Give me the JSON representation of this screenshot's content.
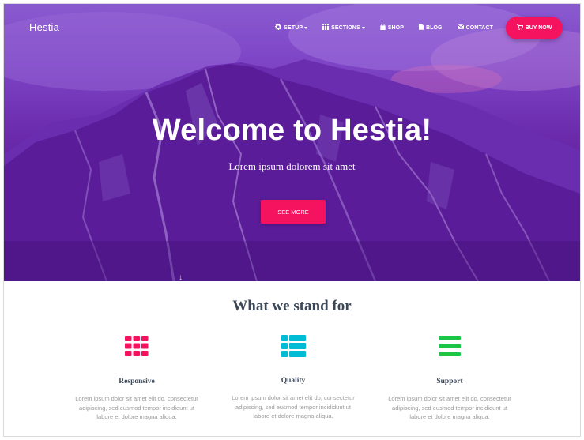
{
  "brand": "Hestia",
  "nav": {
    "items": [
      {
        "label": "SETUP",
        "icon": "gear-icon",
        "dropdown": true
      },
      {
        "label": "SECTIONS",
        "icon": "grid-icon",
        "dropdown": true
      },
      {
        "label": "SHOP",
        "icon": "shopping-bag-icon",
        "dropdown": false
      },
      {
        "label": "BLOG",
        "icon": "file-icon",
        "dropdown": false
      },
      {
        "label": "CONTACT",
        "icon": "envelope-icon",
        "dropdown": false
      }
    ],
    "cta": {
      "label": "BUY NOW",
      "icon": "cart-icon"
    }
  },
  "hero": {
    "title": "Welcome to Hestia!",
    "subtitle": "Lorem ipsum dolorem sit amet",
    "button": "SEE MORE",
    "overlay_color": "#7b2fc4"
  },
  "features": {
    "title": "What we stand for",
    "items": [
      {
        "title": "Responsive",
        "icon": "grid-icon",
        "color": "#f5135f",
        "desc_lines": [
          "Lorem ipsum dolor sit amet elit do, consectetur",
          "adipiscing, sed eusmod tempor incididunt ut",
          "labore et dolore magna aliqua."
        ]
      },
      {
        "title": "Quality",
        "icon": "list-icon",
        "color": "#00bcd4",
        "desc_lines": [
          "Lorem ipsum dolor sit amet elit do, consectetur",
          "adipiscing, sed eusmod tempor incididunt ut",
          "labore et dolore magna aliqua."
        ]
      },
      {
        "title": "Support",
        "icon": "menu-bars-icon",
        "color": "#1cc545",
        "desc_lines": [
          "Lorem ipsum dolor sit amet elit do, consectetur",
          "adipiscing, sed eusmod tempor incididunt ut",
          "labore et dolore magna aliqua."
        ]
      }
    ]
  },
  "colors": {
    "accent": "#f5135f",
    "text": "#3c4858",
    "muted": "#9a9a9a"
  }
}
